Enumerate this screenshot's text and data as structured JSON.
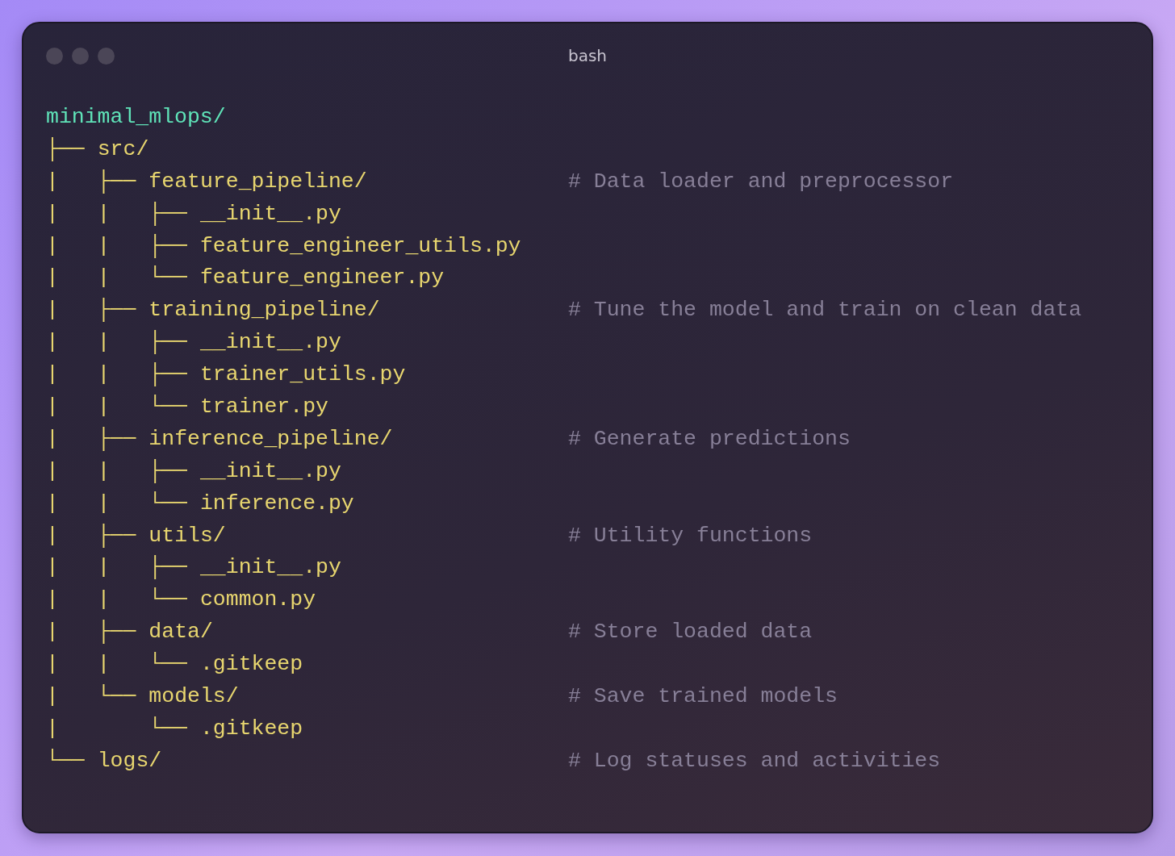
{
  "window": {
    "title": "bash"
  },
  "tree": {
    "name": "minimal_mlops/",
    "children": [
      {
        "prefix": "├──",
        "name": "src/",
        "children": [
          {
            "prefix": "|   ├──",
            "name": "feature_pipeline/",
            "comment": "# Data loader and preprocessor",
            "children": [
              {
                "prefix": "|   |   ├──",
                "name": "__init__.py"
              },
              {
                "prefix": "|   |   ├──",
                "name": "feature_engineer_utils.py"
              },
              {
                "prefix": "|   |   └──",
                "name": "feature_engineer.py"
              }
            ]
          },
          {
            "prefix": "|   ├──",
            "name": "training_pipeline/",
            "comment": "# Tune the model and train on clean data",
            "children": [
              {
                "prefix": "|   |   ├──",
                "name": "__init__.py"
              },
              {
                "prefix": "|   |   ├──",
                "name": "trainer_utils.py"
              },
              {
                "prefix": "|   |   └──",
                "name": "trainer.py"
              }
            ]
          },
          {
            "prefix": "|   ├──",
            "name": "inference_pipeline/",
            "comment": "# Generate predictions",
            "children": [
              {
                "prefix": "|   |   ├──",
                "name": "__init__.py"
              },
              {
                "prefix": "|   |   └──",
                "name": "inference.py"
              }
            ]
          },
          {
            "prefix": "|   ├──",
            "name": "utils/",
            "comment": "# Utility functions",
            "children": [
              {
                "prefix": "|   |   ├──",
                "name": "__init__.py"
              },
              {
                "prefix": "|   |   └──",
                "name": "common.py"
              }
            ]
          },
          {
            "prefix": "|   ├──",
            "name": "data/",
            "comment": "# Store loaded data",
            "children": [
              {
                "prefix": "|   |   └──",
                "name": ".gitkeep"
              }
            ]
          },
          {
            "prefix": "|   └──",
            "name": "models/",
            "comment": "# Save trained models",
            "children": [
              {
                "prefix": "|       └──",
                "name": ".gitkeep"
              }
            ]
          }
        ]
      },
      {
        "prefix": "└──",
        "name": "logs/",
        "comment": "# Log statuses and activities"
      }
    ]
  }
}
